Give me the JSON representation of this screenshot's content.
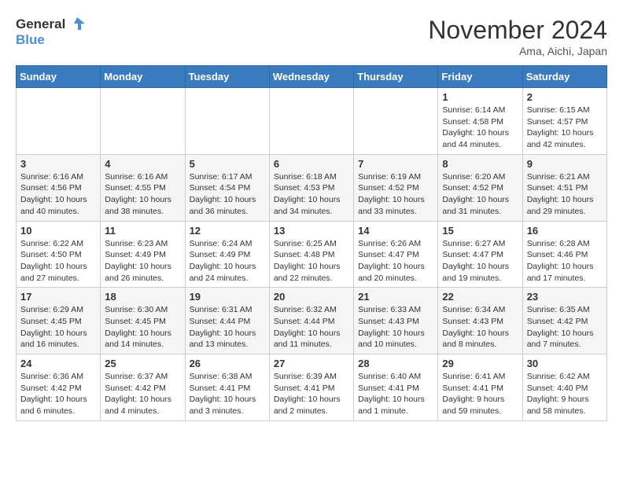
{
  "header": {
    "logo_general": "General",
    "logo_blue": "Blue",
    "month_title": "November 2024",
    "location": "Ama, Aichi, Japan"
  },
  "weekdays": [
    "Sunday",
    "Monday",
    "Tuesday",
    "Wednesday",
    "Thursday",
    "Friday",
    "Saturday"
  ],
  "weeks": [
    [
      {
        "day": "",
        "info": ""
      },
      {
        "day": "",
        "info": ""
      },
      {
        "day": "",
        "info": ""
      },
      {
        "day": "",
        "info": ""
      },
      {
        "day": "",
        "info": ""
      },
      {
        "day": "1",
        "info": "Sunrise: 6:14 AM\nSunset: 4:58 PM\nDaylight: 10 hours\nand 44 minutes."
      },
      {
        "day": "2",
        "info": "Sunrise: 6:15 AM\nSunset: 4:57 PM\nDaylight: 10 hours\nand 42 minutes."
      }
    ],
    [
      {
        "day": "3",
        "info": "Sunrise: 6:16 AM\nSunset: 4:56 PM\nDaylight: 10 hours\nand 40 minutes."
      },
      {
        "day": "4",
        "info": "Sunrise: 6:16 AM\nSunset: 4:55 PM\nDaylight: 10 hours\nand 38 minutes."
      },
      {
        "day": "5",
        "info": "Sunrise: 6:17 AM\nSunset: 4:54 PM\nDaylight: 10 hours\nand 36 minutes."
      },
      {
        "day": "6",
        "info": "Sunrise: 6:18 AM\nSunset: 4:53 PM\nDaylight: 10 hours\nand 34 minutes."
      },
      {
        "day": "7",
        "info": "Sunrise: 6:19 AM\nSunset: 4:52 PM\nDaylight: 10 hours\nand 33 minutes."
      },
      {
        "day": "8",
        "info": "Sunrise: 6:20 AM\nSunset: 4:52 PM\nDaylight: 10 hours\nand 31 minutes."
      },
      {
        "day": "9",
        "info": "Sunrise: 6:21 AM\nSunset: 4:51 PM\nDaylight: 10 hours\nand 29 minutes."
      }
    ],
    [
      {
        "day": "10",
        "info": "Sunrise: 6:22 AM\nSunset: 4:50 PM\nDaylight: 10 hours\nand 27 minutes."
      },
      {
        "day": "11",
        "info": "Sunrise: 6:23 AM\nSunset: 4:49 PM\nDaylight: 10 hours\nand 26 minutes."
      },
      {
        "day": "12",
        "info": "Sunrise: 6:24 AM\nSunset: 4:49 PM\nDaylight: 10 hours\nand 24 minutes."
      },
      {
        "day": "13",
        "info": "Sunrise: 6:25 AM\nSunset: 4:48 PM\nDaylight: 10 hours\nand 22 minutes."
      },
      {
        "day": "14",
        "info": "Sunrise: 6:26 AM\nSunset: 4:47 PM\nDaylight: 10 hours\nand 20 minutes."
      },
      {
        "day": "15",
        "info": "Sunrise: 6:27 AM\nSunset: 4:47 PM\nDaylight: 10 hours\nand 19 minutes."
      },
      {
        "day": "16",
        "info": "Sunrise: 6:28 AM\nSunset: 4:46 PM\nDaylight: 10 hours\nand 17 minutes."
      }
    ],
    [
      {
        "day": "17",
        "info": "Sunrise: 6:29 AM\nSunset: 4:45 PM\nDaylight: 10 hours\nand 16 minutes."
      },
      {
        "day": "18",
        "info": "Sunrise: 6:30 AM\nSunset: 4:45 PM\nDaylight: 10 hours\nand 14 minutes."
      },
      {
        "day": "19",
        "info": "Sunrise: 6:31 AM\nSunset: 4:44 PM\nDaylight: 10 hours\nand 13 minutes."
      },
      {
        "day": "20",
        "info": "Sunrise: 6:32 AM\nSunset: 4:44 PM\nDaylight: 10 hours\nand 11 minutes."
      },
      {
        "day": "21",
        "info": "Sunrise: 6:33 AM\nSunset: 4:43 PM\nDaylight: 10 hours\nand 10 minutes."
      },
      {
        "day": "22",
        "info": "Sunrise: 6:34 AM\nSunset: 4:43 PM\nDaylight: 10 hours\nand 8 minutes."
      },
      {
        "day": "23",
        "info": "Sunrise: 6:35 AM\nSunset: 4:42 PM\nDaylight: 10 hours\nand 7 minutes."
      }
    ],
    [
      {
        "day": "24",
        "info": "Sunrise: 6:36 AM\nSunset: 4:42 PM\nDaylight: 10 hours\nand 6 minutes."
      },
      {
        "day": "25",
        "info": "Sunrise: 6:37 AM\nSunset: 4:42 PM\nDaylight: 10 hours\nand 4 minutes."
      },
      {
        "day": "26",
        "info": "Sunrise: 6:38 AM\nSunset: 4:41 PM\nDaylight: 10 hours\nand 3 minutes."
      },
      {
        "day": "27",
        "info": "Sunrise: 6:39 AM\nSunset: 4:41 PM\nDaylight: 10 hours\nand 2 minutes."
      },
      {
        "day": "28",
        "info": "Sunrise: 6:40 AM\nSunset: 4:41 PM\nDaylight: 10 hours\nand 1 minute."
      },
      {
        "day": "29",
        "info": "Sunrise: 6:41 AM\nSunset: 4:41 PM\nDaylight: 9 hours\nand 59 minutes."
      },
      {
        "day": "30",
        "info": "Sunrise: 6:42 AM\nSunset: 4:40 PM\nDaylight: 9 hours\nand 58 minutes."
      }
    ]
  ]
}
